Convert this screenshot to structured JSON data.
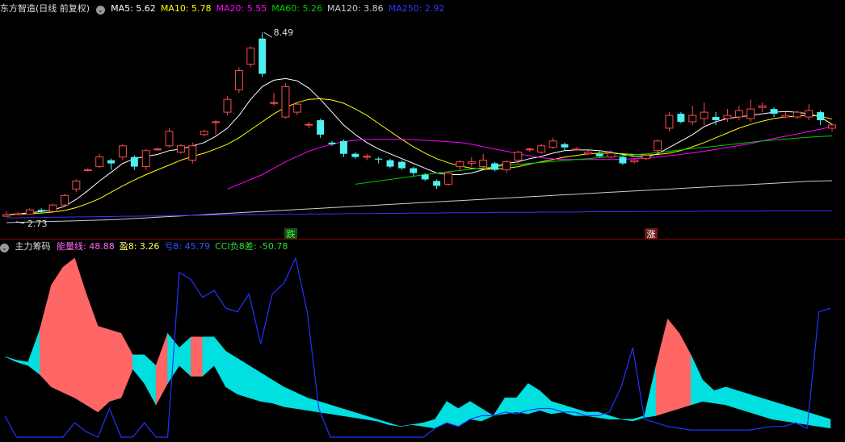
{
  "main_panel": {
    "title": "东方智造(日线 前复权)",
    "ma_labels": [
      {
        "name": "MA5",
        "label": "MA5: 5.62",
        "color": "#ffffff"
      },
      {
        "name": "MA10",
        "label": "MA10: 5.78",
        "color": "#ffff00"
      },
      {
        "name": "MA20",
        "label": "MA20: 5.55",
        "color": "#ff00ff"
      },
      {
        "name": "MA60",
        "label": "MA60: 5.26",
        "color": "#00cc00"
      },
      {
        "name": "MA120",
        "label": "MA120: 3.86",
        "color": "#cccccc"
      },
      {
        "name": "MA250",
        "label": "MA250: 2.92",
        "color": "#3333ff"
      }
    ],
    "high_label": "8.49",
    "low_label": "2.73",
    "marker_down": "跌",
    "marker_up": "涨"
  },
  "sub_panel": {
    "title": "主力筹码",
    "labels": [
      {
        "name": "energy",
        "label": "能量线: 48.88",
        "color": "#ff66ff"
      },
      {
        "name": "profit",
        "label": "盈8: 3.26",
        "color": "#ffff66"
      },
      {
        "name": "loss",
        "label": "亏8: 45.79",
        "color": "#3355ff"
      },
      {
        "name": "cci",
        "label": "CCI负8差: -50.78",
        "color": "#33dd33"
      }
    ]
  },
  "chart_data": [
    {
      "type": "candlestick",
      "ylim": [
        2.4,
        9.0
      ],
      "candles": [
        [
          2.75,
          2.8,
          2.73,
          2.9
        ],
        [
          2.8,
          2.83,
          2.78,
          2.88
        ],
        [
          2.82,
          2.95,
          2.8,
          3.0
        ],
        [
          2.95,
          2.9,
          2.85,
          3.0
        ],
        [
          2.9,
          3.1,
          2.88,
          3.15
        ],
        [
          3.1,
          3.4,
          3.05,
          3.45
        ],
        [
          3.6,
          3.85,
          3.5,
          3.9
        ],
        [
          4.2,
          4.2,
          4.15,
          4.25
        ],
        [
          4.3,
          4.6,
          4.25,
          4.7
        ],
        [
          4.5,
          4.4,
          4.2,
          4.55
        ],
        [
          4.6,
          4.95,
          4.5,
          5.0
        ],
        [
          4.6,
          4.3,
          4.2,
          4.65
        ],
        [
          4.3,
          4.8,
          4.2,
          4.85
        ],
        [
          4.85,
          4.85,
          4.8,
          4.9
        ],
        [
          4.95,
          5.4,
          4.9,
          5.5
        ],
        [
          4.75,
          4.95,
          4.7,
          5.0
        ],
        [
          4.5,
          4.95,
          4.4,
          5.05
        ],
        [
          5.3,
          5.4,
          5.25,
          5.45
        ],
        [
          5.7,
          5.7,
          5.3,
          5.75
        ],
        [
          6.0,
          6.4,
          5.9,
          6.5
        ],
        [
          6.7,
          7.3,
          6.6,
          7.4
        ],
        [
          7.5,
          8.0,
          7.4,
          8.05
        ],
        [
          8.3,
          7.2,
          7.1,
          8.49
        ],
        [
          6.3,
          6.3,
          6.2,
          6.6
        ],
        [
          5.85,
          6.8,
          5.8,
          6.9
        ],
        [
          6.0,
          6.25,
          5.9,
          6.3
        ],
        [
          5.62,
          5.62,
          5.5,
          5.7
        ],
        [
          5.75,
          5.3,
          5.2,
          5.8
        ],
        [
          5.05,
          5.0,
          4.95,
          5.1
        ],
        [
          5.1,
          4.7,
          4.6,
          5.15
        ],
        [
          4.7,
          4.6,
          4.55,
          4.75
        ],
        [
          4.6,
          4.62,
          4.5,
          4.7
        ],
        [
          4.55,
          4.52,
          4.4,
          4.6
        ],
        [
          4.5,
          4.3,
          4.25,
          4.55
        ],
        [
          4.45,
          4.25,
          4.2,
          4.5
        ],
        [
          4.25,
          4.1,
          4.0,
          4.3
        ],
        [
          4.05,
          3.9,
          3.85,
          4.1
        ],
        [
          3.85,
          3.7,
          3.6,
          3.9
        ],
        [
          3.75,
          4.1,
          3.7,
          4.15
        ],
        [
          4.3,
          4.45,
          4.2,
          4.5
        ],
        [
          4.4,
          4.45,
          4.3,
          4.6
        ],
        [
          4.3,
          4.5,
          4.25,
          4.7
        ],
        [
          4.4,
          4.2,
          4.15,
          4.45
        ],
        [
          4.2,
          4.45,
          4.1,
          4.5
        ],
        [
          4.5,
          4.75,
          4.4,
          4.8
        ],
        [
          4.85,
          4.85,
          4.75,
          4.9
        ],
        [
          4.75,
          4.95,
          4.7,
          5.0
        ],
        [
          4.9,
          5.1,
          4.85,
          5.2
        ],
        [
          5.0,
          4.9,
          4.8,
          5.05
        ],
        [
          4.85,
          4.85,
          4.8,
          4.9
        ],
        [
          4.7,
          4.75,
          4.65,
          4.8
        ],
        [
          4.7,
          4.62,
          4.6,
          4.8
        ],
        [
          4.6,
          4.72,
          4.55,
          4.8
        ],
        [
          4.6,
          4.4,
          4.35,
          4.65
        ],
        [
          4.45,
          4.5,
          4.4,
          4.55
        ],
        [
          4.55,
          4.65,
          4.5,
          4.7
        ],
        [
          4.8,
          5.1,
          4.7,
          5.15
        ],
        [
          5.5,
          5.9,
          5.4,
          6.0
        ],
        [
          5.95,
          5.7,
          5.65,
          6.0
        ],
        [
          5.7,
          5.9,
          5.6,
          6.2
        ],
        [
          5.8,
          6.0,
          5.6,
          6.3
        ],
        [
          5.85,
          5.75,
          5.6,
          6.0
        ],
        [
          5.8,
          5.9,
          5.7,
          6.1
        ],
        [
          5.85,
          6.05,
          5.75,
          6.2
        ],
        [
          5.8,
          6.1,
          5.7,
          6.4
        ],
        [
          6.15,
          6.2,
          6.0,
          6.3
        ],
        [
          6.1,
          5.95,
          5.85,
          6.15
        ],
        [
          5.85,
          5.9,
          5.8,
          6.0
        ],
        [
          5.85,
          6.0,
          5.8,
          6.05
        ],
        [
          5.85,
          6.05,
          5.75,
          6.25
        ],
        [
          6.0,
          5.75,
          5.6,
          6.05
        ],
        [
          5.5,
          5.6,
          5.4,
          5.65
        ]
      ],
      "ma_lines": {
        "MA5": [
          2.8,
          2.82,
          2.86,
          2.9,
          2.95,
          3.06,
          3.28,
          3.55,
          3.85,
          4.12,
          4.4,
          4.55,
          4.62,
          4.68,
          4.8,
          4.85,
          4.95,
          5.05,
          5.25,
          5.5,
          5.9,
          6.4,
          6.8,
          7.0,
          7.05,
          6.98,
          6.75,
          6.4,
          6.0,
          5.6,
          5.3,
          5.05,
          4.85,
          4.7,
          4.55,
          4.4,
          4.25,
          4.1,
          4.05,
          4.05,
          4.1,
          4.2,
          4.3,
          4.4,
          4.45,
          4.55,
          4.62,
          4.72,
          4.8,
          4.82,
          4.82,
          4.8,
          4.75,
          4.68,
          4.62,
          4.6,
          4.7,
          4.9,
          5.1,
          5.3,
          5.55,
          5.7,
          5.8,
          5.85,
          5.9,
          5.95,
          6.0,
          6.02,
          6.0,
          5.95,
          5.85,
          5.62
        ],
        "MA10": [
          2.8,
          2.81,
          2.83,
          2.85,
          2.88,
          2.93,
          3.02,
          3.15,
          3.3,
          3.5,
          3.7,
          3.88,
          4.05,
          4.2,
          4.35,
          4.5,
          4.62,
          4.72,
          4.85,
          5.0,
          5.2,
          5.45,
          5.7,
          5.95,
          6.15,
          6.3,
          6.4,
          6.42,
          6.38,
          6.28,
          6.1,
          5.9,
          5.65,
          5.4,
          5.15,
          4.92,
          4.72,
          4.55,
          4.42,
          4.32,
          4.25,
          4.22,
          4.22,
          4.25,
          4.3,
          4.38,
          4.45,
          4.52,
          4.6,
          4.65,
          4.7,
          4.72,
          4.72,
          4.7,
          4.68,
          4.66,
          4.68,
          4.72,
          4.8,
          4.92,
          5.05,
          5.2,
          5.35,
          5.5,
          5.62,
          5.72,
          5.8,
          5.85,
          5.88,
          5.9,
          5.88,
          5.78
        ],
        "MA20": [
          null,
          null,
          null,
          null,
          null,
          null,
          null,
          null,
          null,
          null,
          null,
          null,
          null,
          null,
          null,
          null,
          null,
          null,
          null,
          3.6,
          3.75,
          3.9,
          4.05,
          4.25,
          4.45,
          4.62,
          4.78,
          4.9,
          5.0,
          5.08,
          5.12,
          5.15,
          5.15,
          5.15,
          5.15,
          5.14,
          5.12,
          5.1,
          5.08,
          5.05,
          5.0,
          4.92,
          4.85,
          4.78,
          4.7,
          4.64,
          4.58,
          4.54,
          4.52,
          4.52,
          4.52,
          4.52,
          4.52,
          4.53,
          4.55,
          4.57,
          4.6,
          4.64,
          4.68,
          4.73,
          4.78,
          4.84,
          4.9,
          4.96,
          5.02,
          5.1,
          5.18,
          5.25,
          5.32,
          5.4,
          5.47,
          5.55
        ],
        "MA60": [
          null,
          null,
          null,
          null,
          null,
          null,
          null,
          null,
          null,
          null,
          null,
          null,
          null,
          null,
          null,
          null,
          null,
          null,
          null,
          null,
          null,
          null,
          null,
          null,
          null,
          null,
          null,
          null,
          null,
          null,
          3.75,
          3.8,
          3.85,
          3.9,
          3.95,
          4.0,
          4.05,
          4.1,
          4.14,
          4.18,
          4.22,
          4.26,
          4.3,
          4.34,
          4.37,
          4.4,
          4.43,
          4.46,
          4.49,
          4.52,
          4.55,
          4.58,
          4.61,
          4.64,
          4.67,
          4.7,
          4.74,
          4.78,
          4.82,
          4.86,
          4.9,
          4.94,
          4.98,
          5.02,
          5.06,
          5.1,
          5.13,
          5.16,
          5.19,
          5.22,
          5.24,
          5.26
        ],
        "MA120": [
          2.55,
          2.56,
          2.57,
          2.58,
          2.59,
          2.6,
          2.61,
          2.62,
          2.63,
          2.64,
          2.66,
          2.68,
          2.7,
          2.72,
          2.74,
          2.76,
          2.78,
          2.8,
          2.82,
          2.84,
          2.86,
          2.88,
          2.9,
          2.92,
          2.94,
          2.96,
          2.98,
          3.0,
          3.02,
          3.04,
          3.06,
          3.08,
          3.1,
          3.12,
          3.14,
          3.16,
          3.18,
          3.2,
          3.22,
          3.24,
          3.26,
          3.28,
          3.3,
          3.32,
          3.34,
          3.36,
          3.38,
          3.4,
          3.42,
          3.44,
          3.46,
          3.48,
          3.5,
          3.52,
          3.54,
          3.56,
          3.58,
          3.6,
          3.62,
          3.64,
          3.66,
          3.68,
          3.7,
          3.72,
          3.74,
          3.76,
          3.78,
          3.8,
          3.82,
          3.84,
          3.85,
          3.86
        ],
        "MA250": [
          2.7,
          2.7,
          2.71,
          2.71,
          2.72,
          2.72,
          2.73,
          2.73,
          2.74,
          2.74,
          2.75,
          2.75,
          2.76,
          2.76,
          2.77,
          2.77,
          2.78,
          2.78,
          2.79,
          2.79,
          2.8,
          2.8,
          2.8,
          2.81,
          2.81,
          2.81,
          2.82,
          2.82,
          2.82,
          2.83,
          2.83,
          2.83,
          2.84,
          2.84,
          2.84,
          2.85,
          2.85,
          2.85,
          2.86,
          2.86,
          2.86,
          2.86,
          2.87,
          2.87,
          2.87,
          2.87,
          2.88,
          2.88,
          2.88,
          2.88,
          2.89,
          2.89,
          2.89,
          2.89,
          2.89,
          2.9,
          2.9,
          2.9,
          2.9,
          2.9,
          2.91,
          2.91,
          2.91,
          2.91,
          2.91,
          2.91,
          2.92,
          2.92,
          2.92,
          2.92,
          2.92,
          2.92
        ]
      }
    },
    {
      "type": "area",
      "ylim": [
        0,
        100
      ],
      "upper": [
        45,
        43,
        42,
        60,
        85,
        95,
        100,
        80,
        62,
        60,
        58,
        46,
        46,
        40,
        58,
        50,
        56,
        56,
        56,
        48,
        44,
        40,
        36,
        32,
        28,
        25,
        22,
        20,
        18,
        16,
        14,
        12,
        10,
        8,
        6,
        7,
        8,
        10,
        20,
        16,
        20,
        16,
        12,
        22,
        22,
        30,
        26,
        20,
        18,
        16,
        14,
        14,
        12,
        10,
        10,
        12,
        40,
        66,
        58,
        46,
        32,
        26,
        28,
        26,
        24,
        22,
        20,
        18,
        16,
        14,
        12,
        10
      ],
      "lower": [
        45,
        42,
        40,
        35,
        28,
        25,
        22,
        18,
        14,
        20,
        22,
        38,
        30,
        18,
        30,
        40,
        34,
        34,
        40,
        28,
        24,
        22,
        20,
        19,
        17,
        16,
        15,
        14,
        13,
        12,
        11,
        10,
        9,
        7,
        6,
        7,
        6,
        5,
        8,
        6,
        10,
        9,
        12,
        13,
        14,
        13,
        15,
        13,
        14,
        12,
        12,
        11,
        10,
        10,
        9,
        11,
        12,
        14,
        16,
        18,
        20,
        19,
        18,
        16,
        14,
        12,
        10,
        9,
        8,
        7,
        6,
        5
      ],
      "line": [
        12,
        0,
        0,
        0,
        0,
        0,
        8,
        3,
        0,
        16,
        0,
        0,
        8,
        0,
        0,
        92,
        88,
        78,
        82,
        72,
        70,
        80,
        52,
        80,
        86,
        100,
        70,
        16,
        0,
        0,
        0,
        0,
        0,
        0,
        0,
        0,
        0,
        5,
        8,
        6,
        10,
        12,
        12,
        14,
        13,
        15,
        16,
        16,
        14,
        14,
        12,
        12,
        14,
        28,
        50,
        10,
        8,
        6,
        5,
        4,
        4,
        4,
        4,
        4,
        4,
        5,
        6,
        6,
        8,
        5,
        70,
        72
      ]
    }
  ]
}
